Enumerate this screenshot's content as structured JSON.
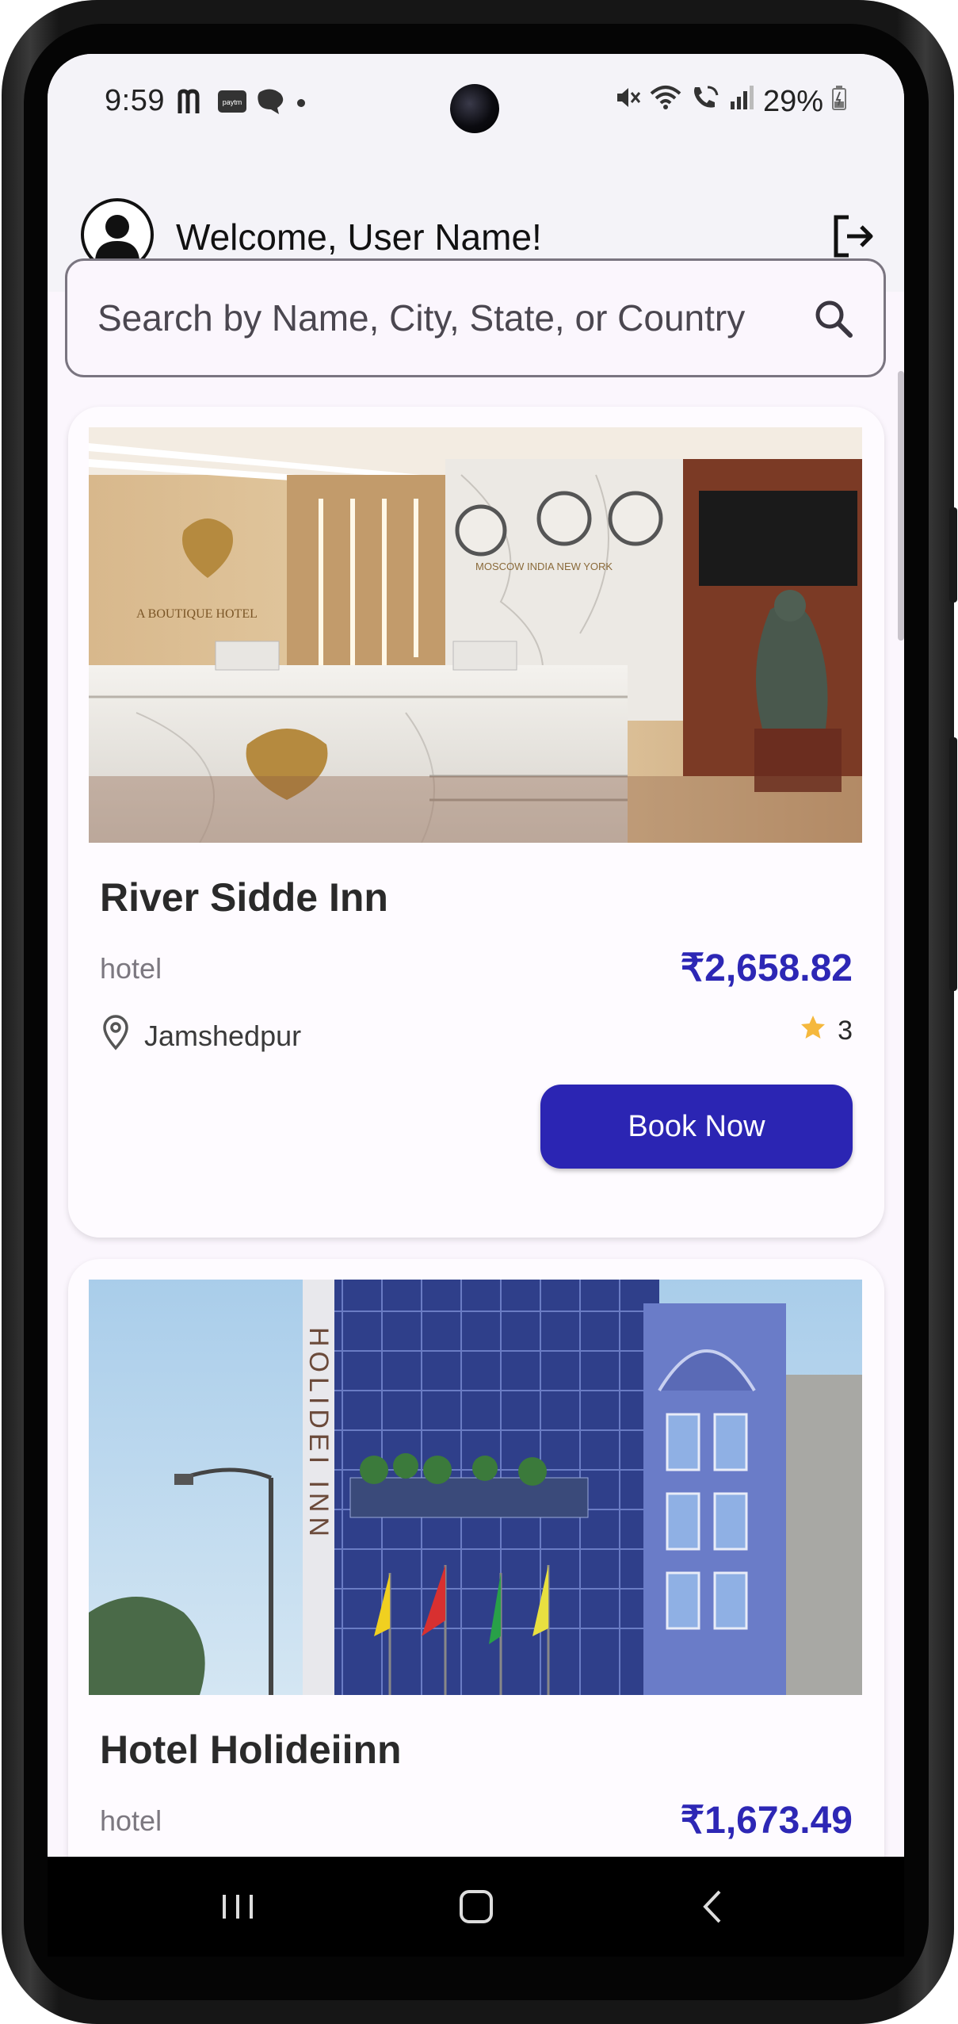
{
  "status_bar": {
    "time": "9:59",
    "left_icons": [
      "m-app-icon",
      "paytm-icon",
      "chat-bubble-icon",
      "dot-icon"
    ],
    "right_icons": [
      "mute-icon",
      "wifi-icon",
      "wifi-call-icon",
      "signal-icon"
    ],
    "battery": "29%"
  },
  "header": {
    "welcome_text": "Welcome, User Name!"
  },
  "search": {
    "placeholder": "Search by Name, City, State, or Country"
  },
  "hotels": [
    {
      "name": "River Sidde Inn",
      "type": "hotel",
      "price": "₹2,658.82",
      "city": "Jamshedpur",
      "rating": "3",
      "book_label": "Book Now",
      "image_sign_text": "A BOUTIQUE HOTEL",
      "image_clock_labels": "MOSCOW   INDIA  NEW YORK"
    },
    {
      "name": "Hotel Holideiinn",
      "type": "hotel",
      "price": "₹1,673.49",
      "image_sign_text": "HOLIDEI INN"
    }
  ],
  "colors": {
    "accent": "#2b25b3",
    "star": "#f5b83d",
    "background": "#fbf6fd"
  }
}
